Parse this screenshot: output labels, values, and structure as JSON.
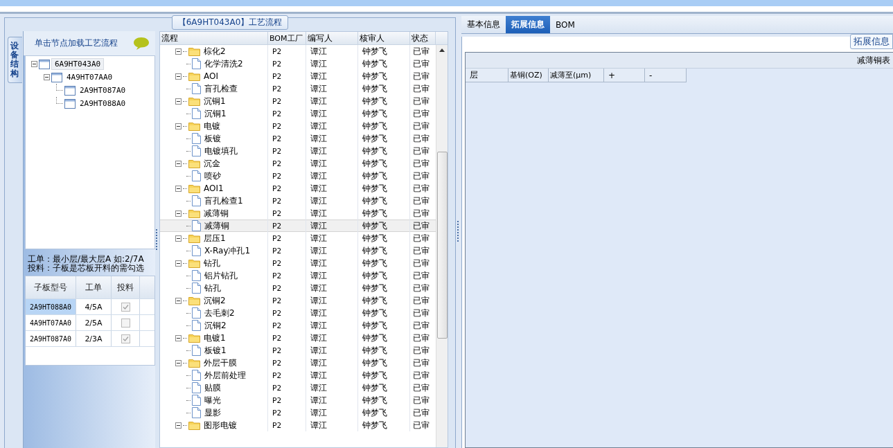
{
  "left_panel": {
    "title": "【6A9HT043A0】工艺流程",
    "side_tab": {
      "label": "设备结构",
      "selected": true
    },
    "tree_header": "单击节点加载工艺流程",
    "device_tree": [
      {
        "label": "6A9HT043A0",
        "selected": true,
        "expanded": true,
        "children": [
          {
            "label": "4A9HT07AA0",
            "selected": false,
            "expanded": true,
            "children": [
              {
                "label": "2A9HT087A0",
                "selected": false
              },
              {
                "label": "2A9HT088A0",
                "selected": false
              }
            ]
          }
        ]
      }
    ],
    "notes": [
      "工单：最小层/最大层A 如:2/7A",
      "投料：子板是芯板开料的需勾选"
    ],
    "sub_board_grid": {
      "columns": [
        "子板型号",
        "工单",
        "投料"
      ],
      "rows": [
        {
          "model": "2A9HT088A0",
          "work_order": "4/5A",
          "feed": true,
          "selected": true
        },
        {
          "model": "4A9HT07AA0",
          "work_order": "2/5A",
          "feed": false,
          "selected": false
        },
        {
          "model": "2A9HT087A0",
          "work_order": "2/3A",
          "feed": true,
          "selected": false
        }
      ]
    }
  },
  "process_grid": {
    "columns": [
      "流程",
      "BOM工厂",
      "编写人",
      "核审人",
      "状态"
    ],
    "rows": [
      {
        "name": "棕化2",
        "kind": "folder",
        "expanded": true,
        "bom_plant": "P2",
        "writer": "谭江",
        "reviewer": "钟梦飞",
        "status": "已审",
        "selected": false,
        "children": [
          {
            "name": "化学清洗2",
            "kind": "file",
            "bom_plant": "P2",
            "writer": "谭江",
            "reviewer": "钟梦飞",
            "status": "已审",
            "selected": false
          }
        ]
      },
      {
        "name": "AOI",
        "kind": "folder",
        "expanded": true,
        "bom_plant": "P2",
        "writer": "谭江",
        "reviewer": "钟梦飞",
        "status": "已审",
        "selected": false,
        "children": [
          {
            "name": "盲孔检查",
            "kind": "file",
            "bom_plant": "P2",
            "writer": "谭江",
            "reviewer": "钟梦飞",
            "status": "已审",
            "selected": false
          }
        ]
      },
      {
        "name": "沉铜1",
        "kind": "folder",
        "expanded": true,
        "bom_plant": "P2",
        "writer": "谭江",
        "reviewer": "钟梦飞",
        "status": "已审",
        "selected": false,
        "children": [
          {
            "name": "沉铜1",
            "kind": "file",
            "bom_plant": "P2",
            "writer": "谭江",
            "reviewer": "钟梦飞",
            "status": "已审",
            "selected": false
          }
        ]
      },
      {
        "name": "电镀",
        "kind": "folder",
        "expanded": true,
        "bom_plant": "P2",
        "writer": "谭江",
        "reviewer": "钟梦飞",
        "status": "已审",
        "selected": false,
        "children": [
          {
            "name": "板镀",
            "kind": "file",
            "bom_plant": "P2",
            "writer": "谭江",
            "reviewer": "钟梦飞",
            "status": "已审",
            "selected": false
          },
          {
            "name": "电镀填孔",
            "kind": "file",
            "bom_plant": "P2",
            "writer": "谭江",
            "reviewer": "钟梦飞",
            "status": "已审",
            "selected": false
          }
        ]
      },
      {
        "name": "沉金",
        "kind": "folder",
        "expanded": true,
        "bom_plant": "P2",
        "writer": "谭江",
        "reviewer": "钟梦飞",
        "status": "已审",
        "selected": false,
        "children": [
          {
            "name": "喷砂",
            "kind": "file",
            "bom_plant": "P2",
            "writer": "谭江",
            "reviewer": "钟梦飞",
            "status": "已审",
            "selected": false
          }
        ]
      },
      {
        "name": "AOI1",
        "kind": "folder",
        "expanded": true,
        "bom_plant": "P2",
        "writer": "谭江",
        "reviewer": "钟梦飞",
        "status": "已审",
        "selected": false,
        "children": [
          {
            "name": "盲孔检查1",
            "kind": "file",
            "bom_plant": "P2",
            "writer": "谭江",
            "reviewer": "钟梦飞",
            "status": "已审",
            "selected": false
          }
        ]
      },
      {
        "name": "减薄铜",
        "kind": "folder",
        "expanded": true,
        "bom_plant": "P2",
        "writer": "谭江",
        "reviewer": "钟梦飞",
        "status": "已审",
        "selected": false,
        "children": [
          {
            "name": "减薄铜",
            "kind": "file",
            "bom_plant": "P2",
            "writer": "谭江",
            "reviewer": "钟梦飞",
            "status": "已审",
            "selected": true
          }
        ]
      },
      {
        "name": "层压1",
        "kind": "folder",
        "expanded": true,
        "bom_plant": "P2",
        "writer": "谭江",
        "reviewer": "钟梦飞",
        "status": "已审",
        "selected": false,
        "children": [
          {
            "name": "X-Ray冲孔1",
            "kind": "file",
            "bom_plant": "P2",
            "writer": "谭江",
            "reviewer": "钟梦飞",
            "status": "已审",
            "selected": false
          }
        ]
      },
      {
        "name": "钻孔",
        "kind": "folder",
        "expanded": true,
        "bom_plant": "P2",
        "writer": "谭江",
        "reviewer": "钟梦飞",
        "status": "已审",
        "selected": false,
        "children": [
          {
            "name": "铝片钻孔",
            "kind": "file",
            "bom_plant": "P2",
            "writer": "谭江",
            "reviewer": "钟梦飞",
            "status": "已审",
            "selected": false
          },
          {
            "name": "钻孔",
            "kind": "file",
            "bom_plant": "P2",
            "writer": "谭江",
            "reviewer": "钟梦飞",
            "status": "已审",
            "selected": false
          }
        ]
      },
      {
        "name": "沉铜2",
        "kind": "folder",
        "expanded": true,
        "bom_plant": "P2",
        "writer": "谭江",
        "reviewer": "钟梦飞",
        "status": "已审",
        "selected": false,
        "children": [
          {
            "name": "去毛刺2",
            "kind": "file",
            "bom_plant": "P2",
            "writer": "谭江",
            "reviewer": "钟梦飞",
            "status": "已审",
            "selected": false
          },
          {
            "name": "沉铜2",
            "kind": "file",
            "bom_plant": "P2",
            "writer": "谭江",
            "reviewer": "钟梦飞",
            "status": "已审",
            "selected": false
          }
        ]
      },
      {
        "name": "电镀1",
        "kind": "folder",
        "expanded": true,
        "bom_plant": "P2",
        "writer": "谭江",
        "reviewer": "钟梦飞",
        "status": "已审",
        "selected": false,
        "children": [
          {
            "name": "板镀1",
            "kind": "file",
            "bom_plant": "P2",
            "writer": "谭江",
            "reviewer": "钟梦飞",
            "status": "已审",
            "selected": false
          }
        ]
      },
      {
        "name": "外层干膜",
        "kind": "folder",
        "expanded": true,
        "bom_plant": "P2",
        "writer": "谭江",
        "reviewer": "钟梦飞",
        "status": "已审",
        "selected": false,
        "children": [
          {
            "name": "外层前处理",
            "kind": "file",
            "bom_plant": "P2",
            "writer": "谭江",
            "reviewer": "钟梦飞",
            "status": "已审",
            "selected": false
          },
          {
            "name": "贴膜",
            "kind": "file",
            "bom_plant": "P2",
            "writer": "谭江",
            "reviewer": "钟梦飞",
            "status": "已审",
            "selected": false
          },
          {
            "name": "曝光",
            "kind": "file",
            "bom_plant": "P2",
            "writer": "谭江",
            "reviewer": "钟梦飞",
            "status": "已审",
            "selected": false
          },
          {
            "name": "显影",
            "kind": "file",
            "bom_plant": "P2",
            "writer": "谭江",
            "reviewer": "钟梦飞",
            "status": "已审",
            "selected": false
          }
        ]
      },
      {
        "name": "图形电镀",
        "kind": "folder",
        "expanded": true,
        "bom_plant": "P2",
        "writer": "谭江",
        "reviewer": "钟梦飞",
        "status": "已审",
        "selected": false
      }
    ]
  },
  "right_panel": {
    "tabs": [
      {
        "label": "基本信息",
        "selected": false
      },
      {
        "label": "拓展信息",
        "selected": true
      },
      {
        "label": "BOM",
        "selected": false
      }
    ],
    "group_title": "拓展信息",
    "table_title": "减薄铜表",
    "columns": [
      "层",
      "基铜(OZ)",
      "减薄至(μm)",
      "+",
      "-"
    ]
  }
}
